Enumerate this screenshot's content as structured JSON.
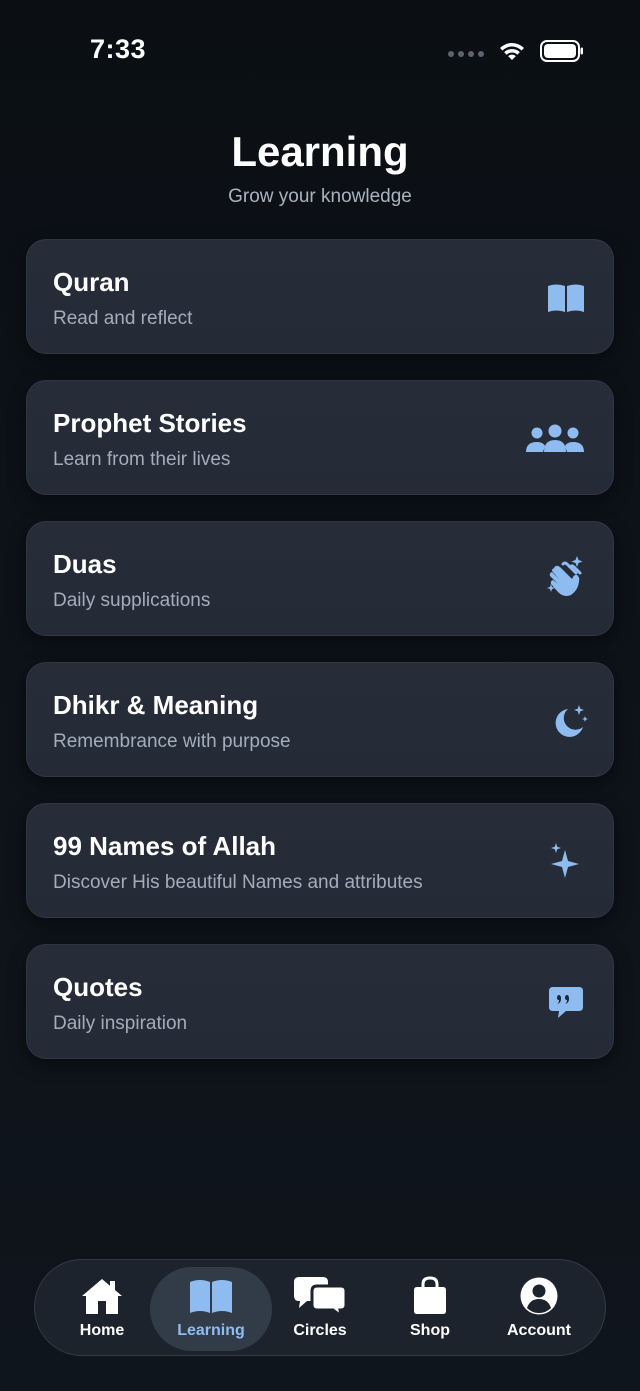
{
  "status_bar": {
    "time": "7:33"
  },
  "header": {
    "title": "Learning",
    "subtitle": "Grow your knowledge"
  },
  "colors": {
    "accent": "#8fbcf0",
    "card_bg": "#252c37",
    "background": "#0d1218"
  },
  "cards": [
    {
      "title": "Quran",
      "subtitle": "Read and reflect",
      "icon": "book-open-icon"
    },
    {
      "title": "Prophet Stories",
      "subtitle": "Learn from their lives",
      "icon": "people-group-icon"
    },
    {
      "title": "Duas",
      "subtitle": "Daily supplications",
      "icon": "praying-hands-icon"
    },
    {
      "title": "Dhikr & Meaning",
      "subtitle": "Remembrance with purpose",
      "icon": "moon-star-icon"
    },
    {
      "title": "99 Names of Allah",
      "subtitle": "Discover His beautiful Names and attributes",
      "icon": "sparkles-icon"
    },
    {
      "title": "Quotes",
      "subtitle": "Daily inspiration",
      "icon": "quote-bubble-icon"
    }
  ],
  "tab_bar": {
    "active": "Learning",
    "tabs": [
      {
        "label": "Home",
        "icon": "home-icon"
      },
      {
        "label": "Learning",
        "icon": "book-open-icon"
      },
      {
        "label": "Circles",
        "icon": "chat-bubbles-icon"
      },
      {
        "label": "Shop",
        "icon": "shopping-bag-icon"
      },
      {
        "label": "Account",
        "icon": "account-icon"
      }
    ]
  }
}
